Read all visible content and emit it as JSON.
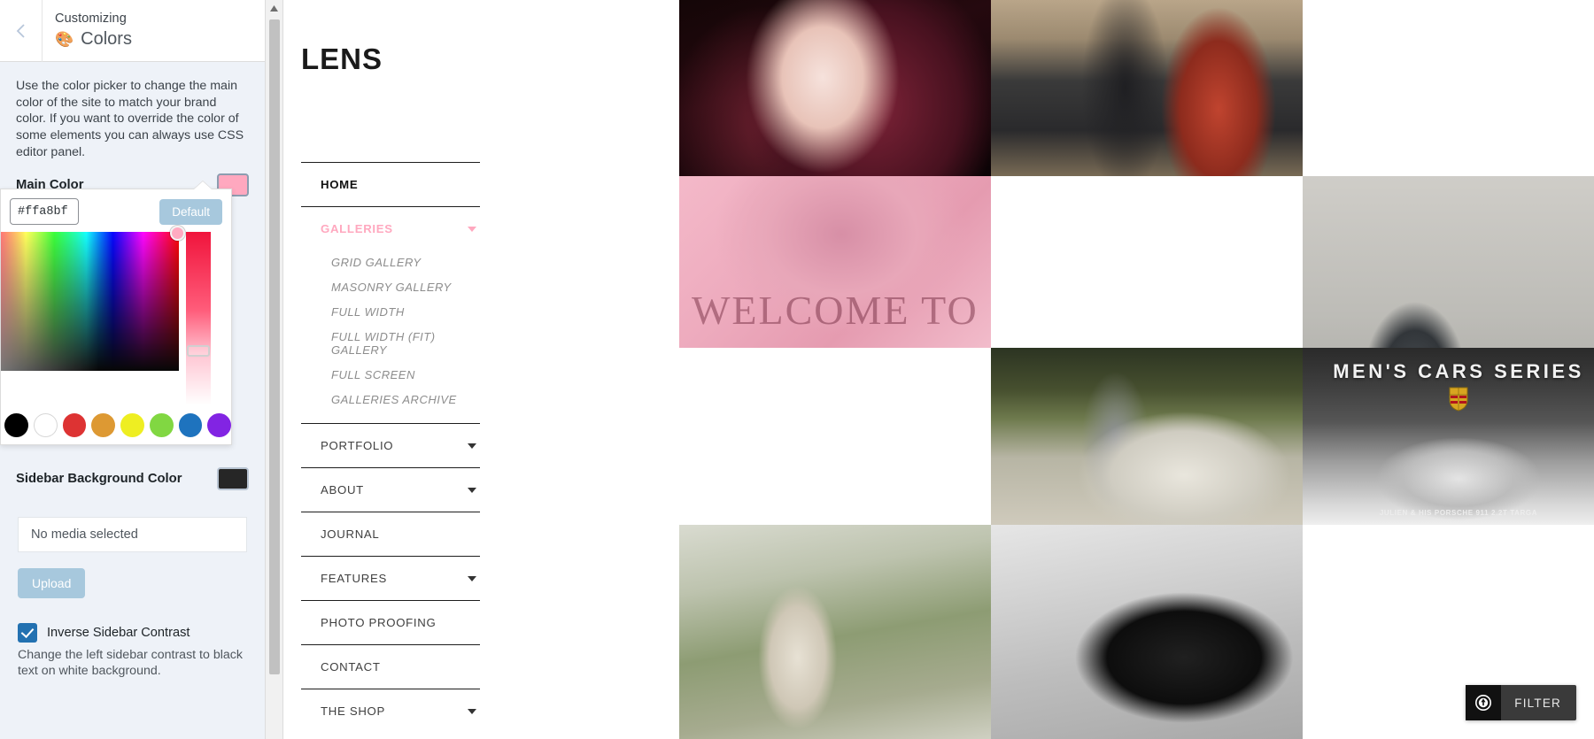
{
  "customizer": {
    "back_icon": "chevron-left-icon",
    "breadcrumb": "Customizing",
    "section_icon": "palette-icon",
    "section_title": "Colors",
    "description": "Use the color picker to change the main color of the site to match your brand color. If you want to override the color of some elements you can always use CSS editor panel.",
    "main_color": {
      "label": "Main Color",
      "value": "#ffa8bf",
      "default_label": "Default",
      "swatches": [
        "#000000",
        "#ffffff",
        "#dd3333",
        "#dd9933",
        "#eeee22",
        "#81d742",
        "#1e73be",
        "#8224e3"
      ]
    },
    "sidebar_background": {
      "label": "Sidebar Background Color",
      "value": "#262626"
    },
    "media": {
      "status": "No media selected",
      "upload_label": "Upload"
    },
    "inverse_contrast": {
      "label": "Inverse Sidebar Contrast",
      "description": "Change the left sidebar contrast to black text on white background.",
      "checked": true
    }
  },
  "site": {
    "logo": "LENS",
    "nav": [
      {
        "label": "HOME",
        "style": "home",
        "caret": false
      },
      {
        "label": "GALLERIES",
        "style": "active",
        "caret": true,
        "children": [
          "GRID GALLERY",
          "MASONRY GALLERY",
          "FULL WIDTH",
          "FULL WIDTH (FIT) GALLERY",
          "FULL SCREEN",
          "GALLERIES ARCHIVE"
        ]
      },
      {
        "label": "PORTFOLIO",
        "style": "",
        "caret": true
      },
      {
        "label": "ABOUT",
        "style": "",
        "caret": true
      },
      {
        "label": "JOURNAL",
        "style": "",
        "caret": false
      },
      {
        "label": "FEATURES",
        "style": "",
        "caret": true
      },
      {
        "label": "PHOTO PROOFING",
        "style": "",
        "caret": false
      },
      {
        "label": "CONTACT",
        "style": "",
        "caret": false
      },
      {
        "label": "THE SHOP",
        "style": "",
        "caret": true
      }
    ],
    "hero": {
      "overlay_text": "WELCOME TO LENS"
    },
    "mens_series": {
      "title": "MEN'S CARS SERIES",
      "caption": "JULIEN & HIS PORSCHE 911 2.2T TARGA"
    },
    "filter": {
      "label": "FILTER",
      "icon": "filter-circle-icon"
    }
  }
}
